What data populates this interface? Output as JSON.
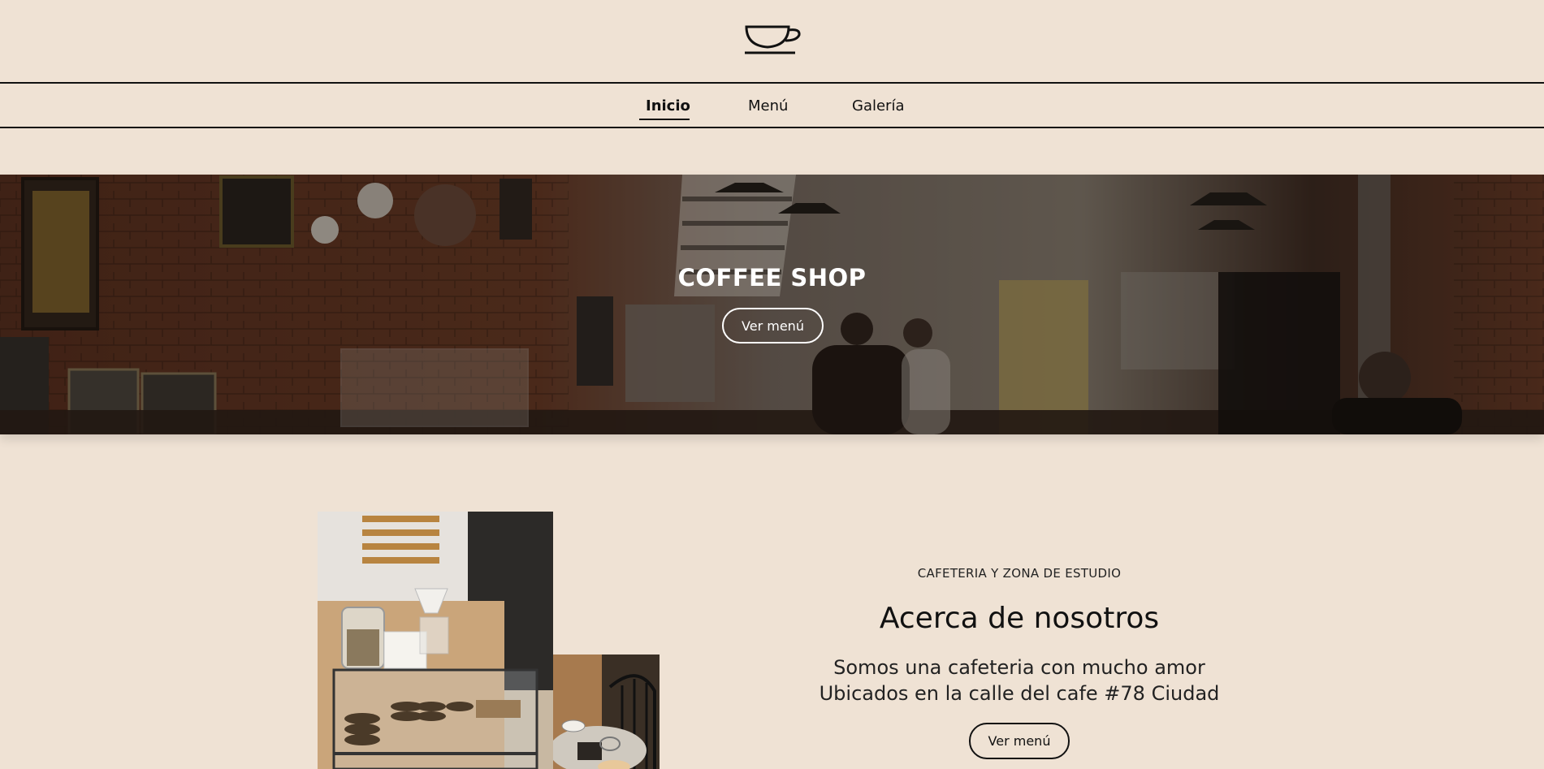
{
  "header": {
    "logo_icon": "coffee-cup-icon"
  },
  "nav": {
    "items": [
      {
        "label": "Inicio",
        "active": true
      },
      {
        "label": "Menú",
        "active": false
      },
      {
        "label": "Galería",
        "active": false
      }
    ]
  },
  "hero": {
    "title": "COFFEE SHOP",
    "button_label": "Ver menú"
  },
  "about": {
    "kicker": "CAFETERIA Y ZONA DE ESTUDIO",
    "heading": "Acerca de nosotros",
    "description_line1": "Somos una cafeteria con mucho amor",
    "description_line2": "Ubicados en la calle del cafe #78 Ciudad",
    "button_label": "Ver menú"
  },
  "colors": {
    "background": "#efe2d4",
    "text": "#111111",
    "hero_text": "#ffffff"
  }
}
